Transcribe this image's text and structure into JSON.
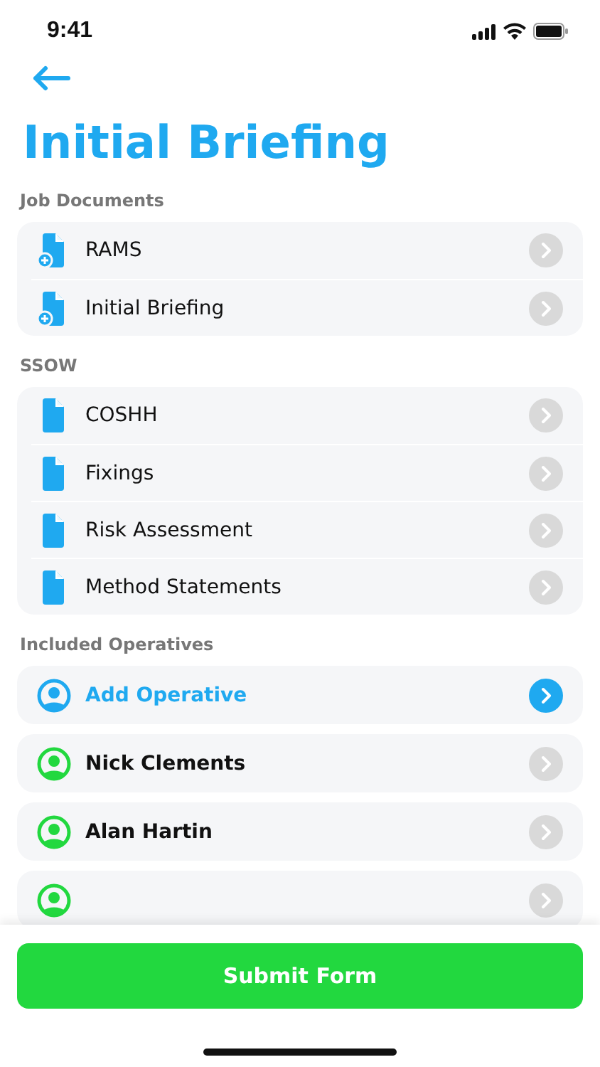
{
  "status_bar": {
    "time": "9:41"
  },
  "title": "Initial Briefing",
  "sections": [
    {
      "heading": "Job Documents",
      "items": [
        {
          "label": "RAMS",
          "kind": "doc-add"
        },
        {
          "label": "Initial Briefing",
          "kind": "doc-add"
        }
      ]
    },
    {
      "heading": "SSOW",
      "items": [
        {
          "label": "COSHH",
          "kind": "doc"
        },
        {
          "label": "Fixings",
          "kind": "doc"
        },
        {
          "label": "Risk Assessment",
          "kind": "doc"
        },
        {
          "label": "Method Statements",
          "kind": "doc"
        }
      ]
    }
  ],
  "operatives": {
    "heading": "Included Operatives",
    "items": [
      {
        "label": "Add Operative",
        "kind": "add"
      },
      {
        "label": "Nick Clements",
        "kind": "person"
      },
      {
        "label": "Alan Hartin",
        "kind": "person"
      },
      {
        "kind": "person"
      }
    ]
  },
  "submit": "Submit Form"
}
